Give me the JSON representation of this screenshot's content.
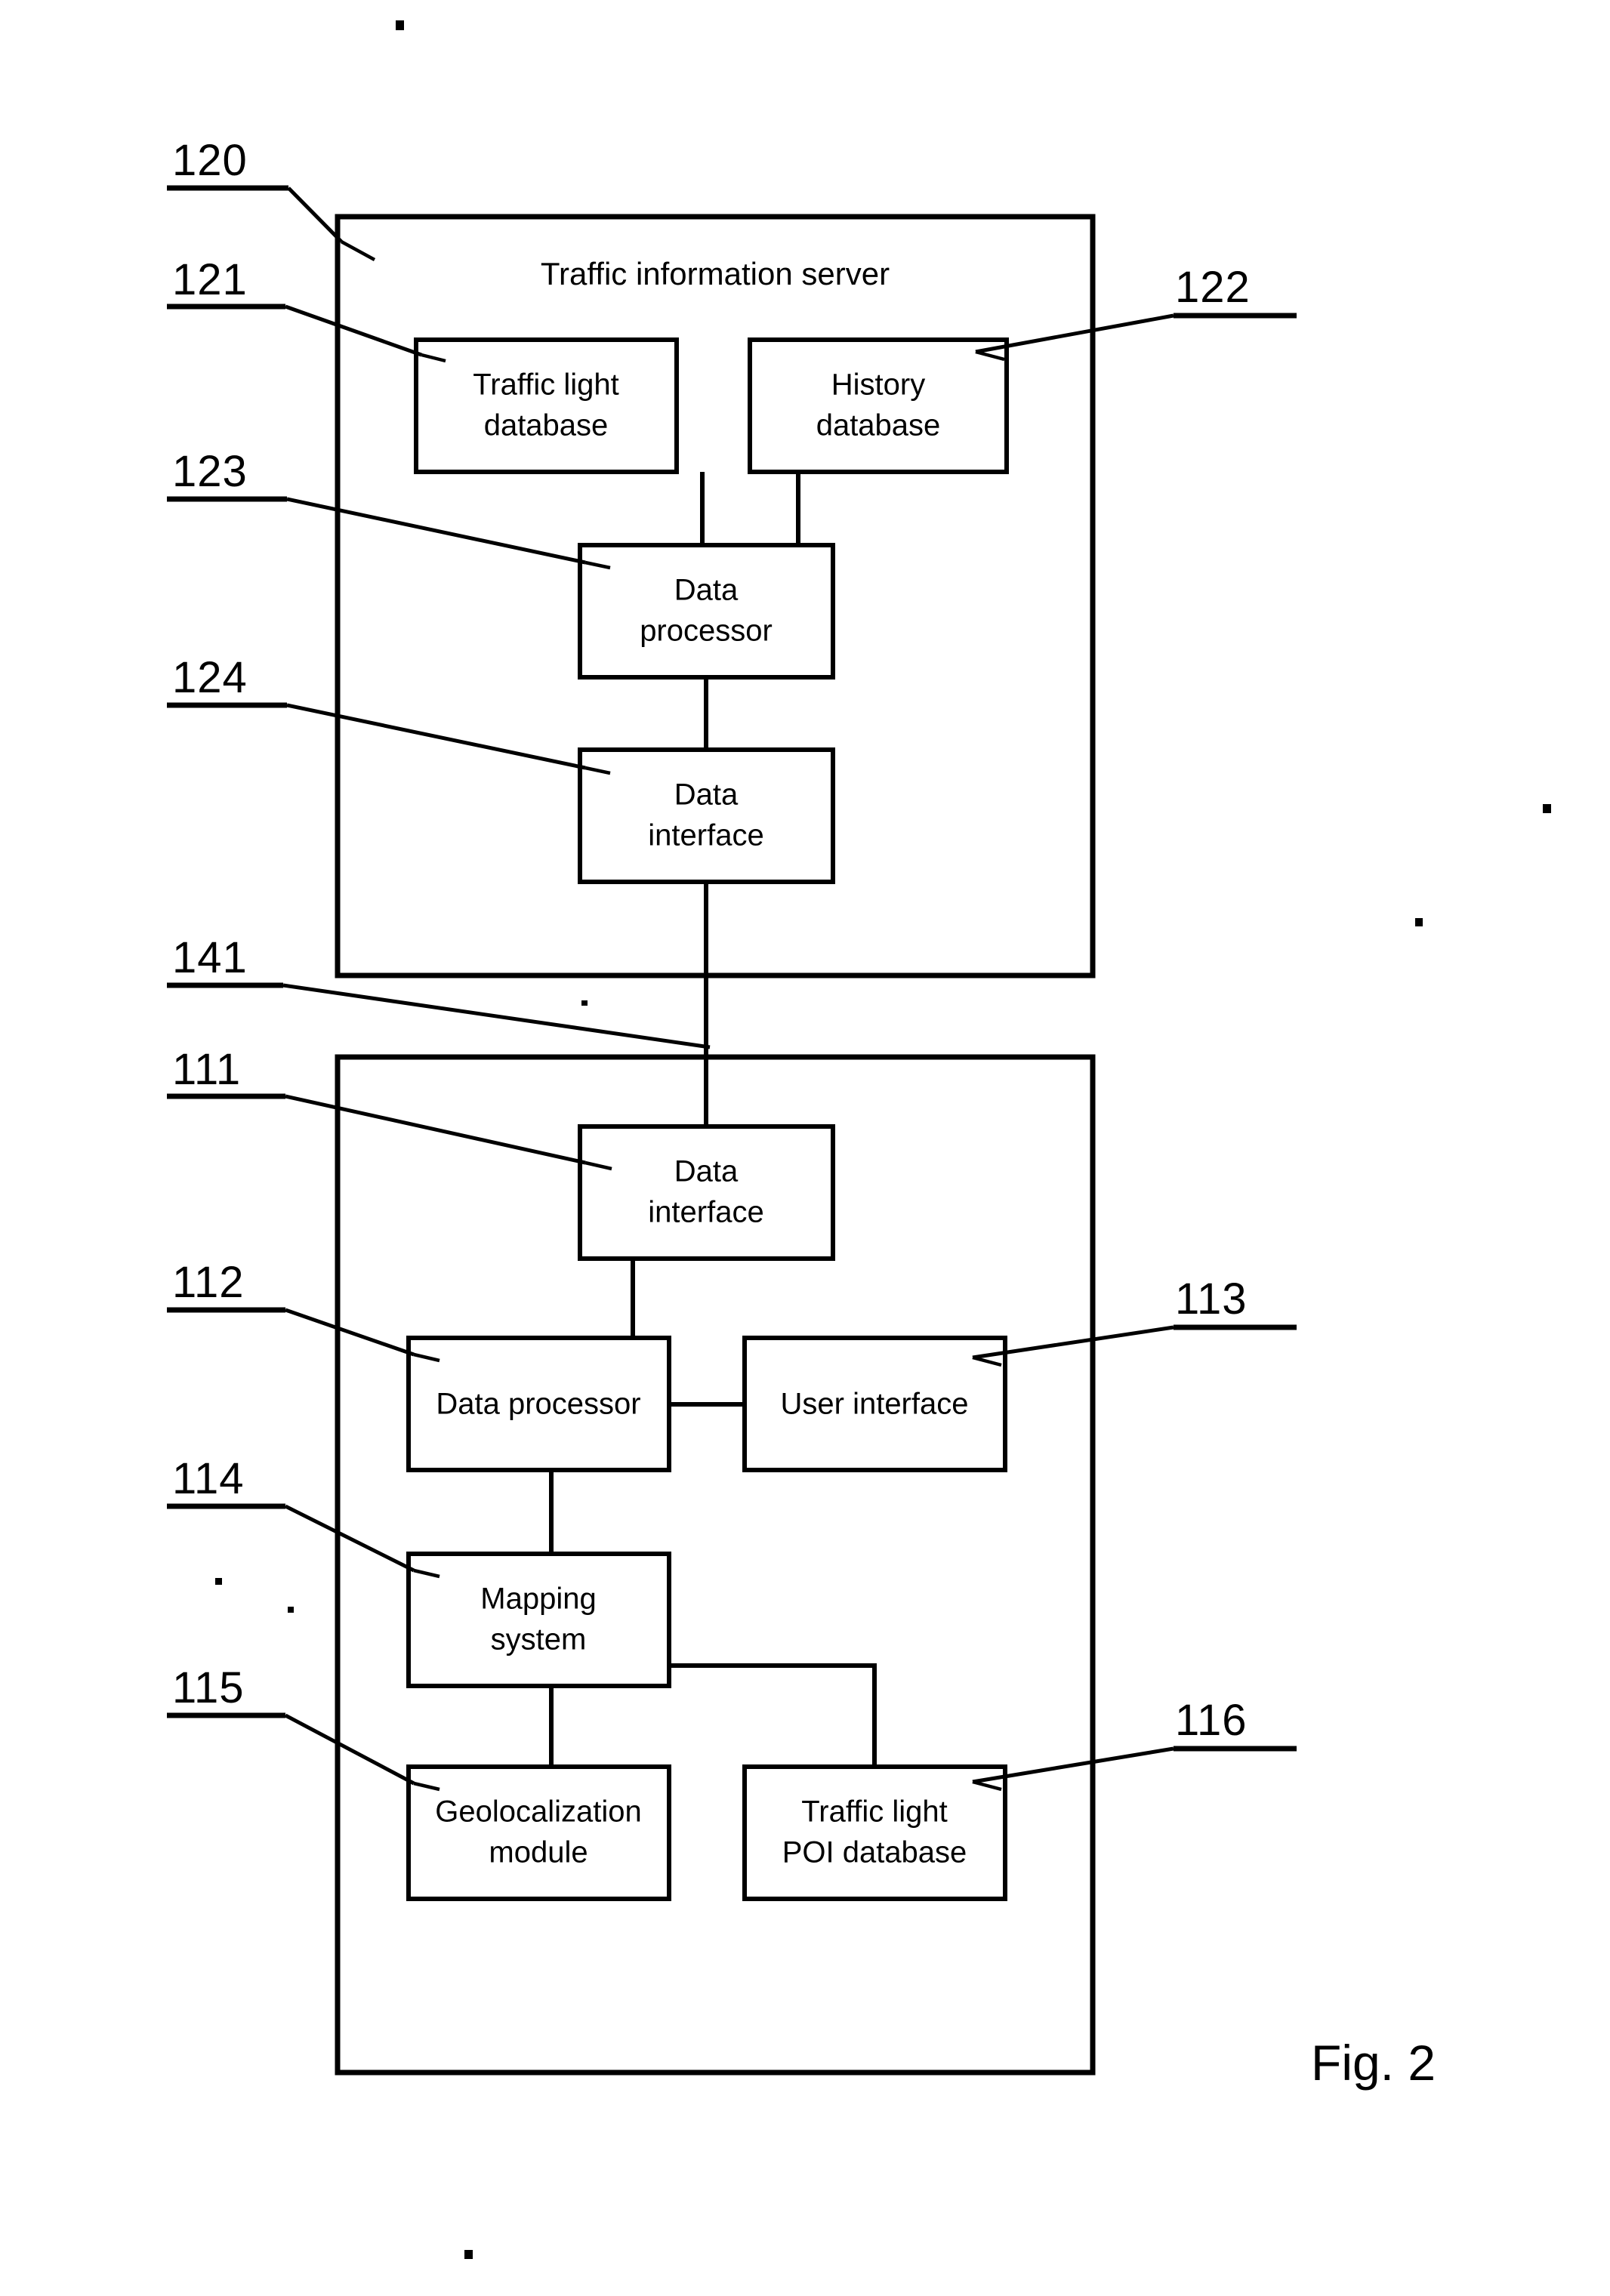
{
  "figure": {
    "caption": "Fig. 2",
    "containers": [
      {
        "id": "traffic-information-server",
        "title": "Traffic information server",
        "ref": "120"
      },
      {
        "id": "mobile-device",
        "title": "",
        "ref": ""
      }
    ],
    "nodes": [
      {
        "id": "traffic-light-database",
        "ref": "121",
        "lines": [
          "Traffic light",
          "database"
        ]
      },
      {
        "id": "history-database",
        "ref": "122",
        "lines": [
          "History",
          "database"
        ]
      },
      {
        "id": "server-data-processor",
        "ref": "123",
        "lines": [
          "Data",
          "processor"
        ]
      },
      {
        "id": "server-data-interface",
        "ref": "124",
        "lines": [
          "Data",
          "interface"
        ]
      },
      {
        "id": "client-data-interface",
        "ref": "111",
        "lines": [
          "Data",
          "interface"
        ]
      },
      {
        "id": "client-data-processor",
        "ref": "112",
        "lines": [
          "Data processor"
        ]
      },
      {
        "id": "user-interface",
        "ref": "113",
        "lines": [
          "User interface"
        ]
      },
      {
        "id": "mapping-system",
        "ref": "114",
        "lines": [
          "Mapping",
          "system"
        ]
      },
      {
        "id": "geolocalization-module",
        "ref": "115",
        "lines": [
          "Geolocalization",
          "module"
        ]
      },
      {
        "id": "traffic-light-poi-database",
        "ref": "116",
        "lines": [
          "Traffic light",
          "POI database"
        ]
      }
    ],
    "link_ref": "141",
    "ref_numbers": [
      "120",
      "121",
      "122",
      "123",
      "124",
      "141",
      "111",
      "112",
      "113",
      "114",
      "115",
      "116"
    ],
    "colors": {
      "stroke": "#000000",
      "background": "#ffffff",
      "text": "#000000"
    }
  }
}
